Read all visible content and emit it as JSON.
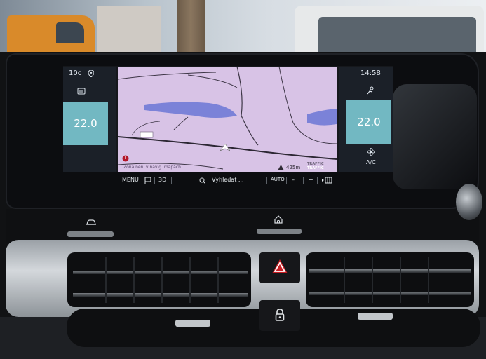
{
  "screen": {
    "left_panel": {
      "outside_temp": "10c",
      "temp_setpoint": "22.0"
    },
    "right_panel": {
      "time": "14:58",
      "temp_setpoint": "22.0",
      "ac_label": "A/C"
    },
    "map": {
      "place_label": "",
      "zone_note": "Zóna není v navig. mapách",
      "scale": "425m",
      "traffic_label_1": "TRAFFIC",
      "traffic_label_2": "TRAFFIC"
    },
    "toolbar": {
      "menu_label": "MENU",
      "view_label": "3D",
      "search_label": "Vyhledat ...",
      "zoom_mode_label": "AUTO",
      "zoom_out": "–",
      "zoom_in": "+"
    }
  },
  "colors": {
    "map_background": "#d8c3e6",
    "water": "#7b82d8",
    "climate_tile": "#72b8c2",
    "hazard": "#c81e24"
  },
  "icons": [
    "location-pin-icon",
    "rear-defrost-icon",
    "seat-heat-icon",
    "fan-icon",
    "position-arrow-icon",
    "flag-icon",
    "search-icon",
    "panel-toggle-icon",
    "car-icon",
    "home-icon",
    "hazard-triangle-icon",
    "lock-icon"
  ]
}
